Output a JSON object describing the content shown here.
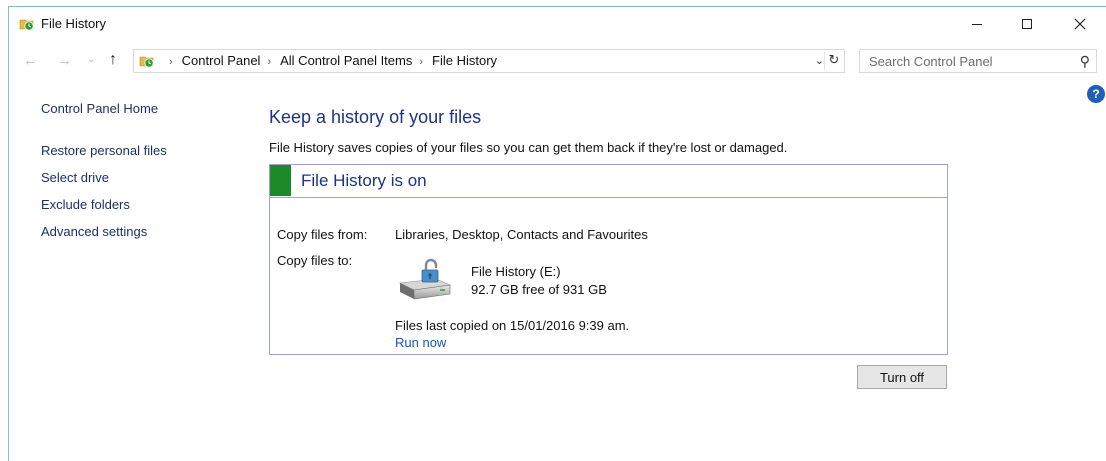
{
  "window": {
    "title": "File History"
  },
  "nav": {
    "back_glyph": "←",
    "forward_glyph": "→",
    "recent_glyph": "⌄",
    "up_glyph": "↑"
  },
  "address": {
    "crumbs": [
      "Control Panel",
      "All Control Panel Items",
      "File History"
    ],
    "separator": "›"
  },
  "search": {
    "placeholder": "Search Control Panel"
  },
  "sidebar": {
    "home": "Control Panel Home",
    "items": [
      {
        "label": "Restore personal files"
      },
      {
        "label": "Select drive"
      },
      {
        "label": "Exclude folders"
      },
      {
        "label": "Advanced settings"
      }
    ]
  },
  "main": {
    "title": "Keep a history of your files",
    "description": "File History saves copies of your files so you can get them back if they're lost or damaged.",
    "status": {
      "title": "File History is on",
      "color": "#1d8a2a"
    },
    "copy_from_label": "Copy files from:",
    "copy_from_value": "Libraries, Desktop, Contacts and Favourites",
    "copy_to_label": "Copy files to:",
    "drive_name": "File History (E:)",
    "drive_space": "92.7 GB free of 931 GB",
    "last_copied": "Files last copied on 15/01/2016 9:39 am.",
    "run_now": "Run now",
    "turn_off": "Turn off"
  },
  "colors": {
    "accent": "#1e3287",
    "link": "#1b56b3",
    "help": "#1f5fb4"
  },
  "icons": [
    "file-history-icon",
    "minimize-icon",
    "maximize-icon",
    "close-icon",
    "back-arrow-icon",
    "forward-arrow-icon",
    "up-arrow-icon",
    "refresh-icon",
    "search-icon",
    "help-icon",
    "drive-icon"
  ]
}
